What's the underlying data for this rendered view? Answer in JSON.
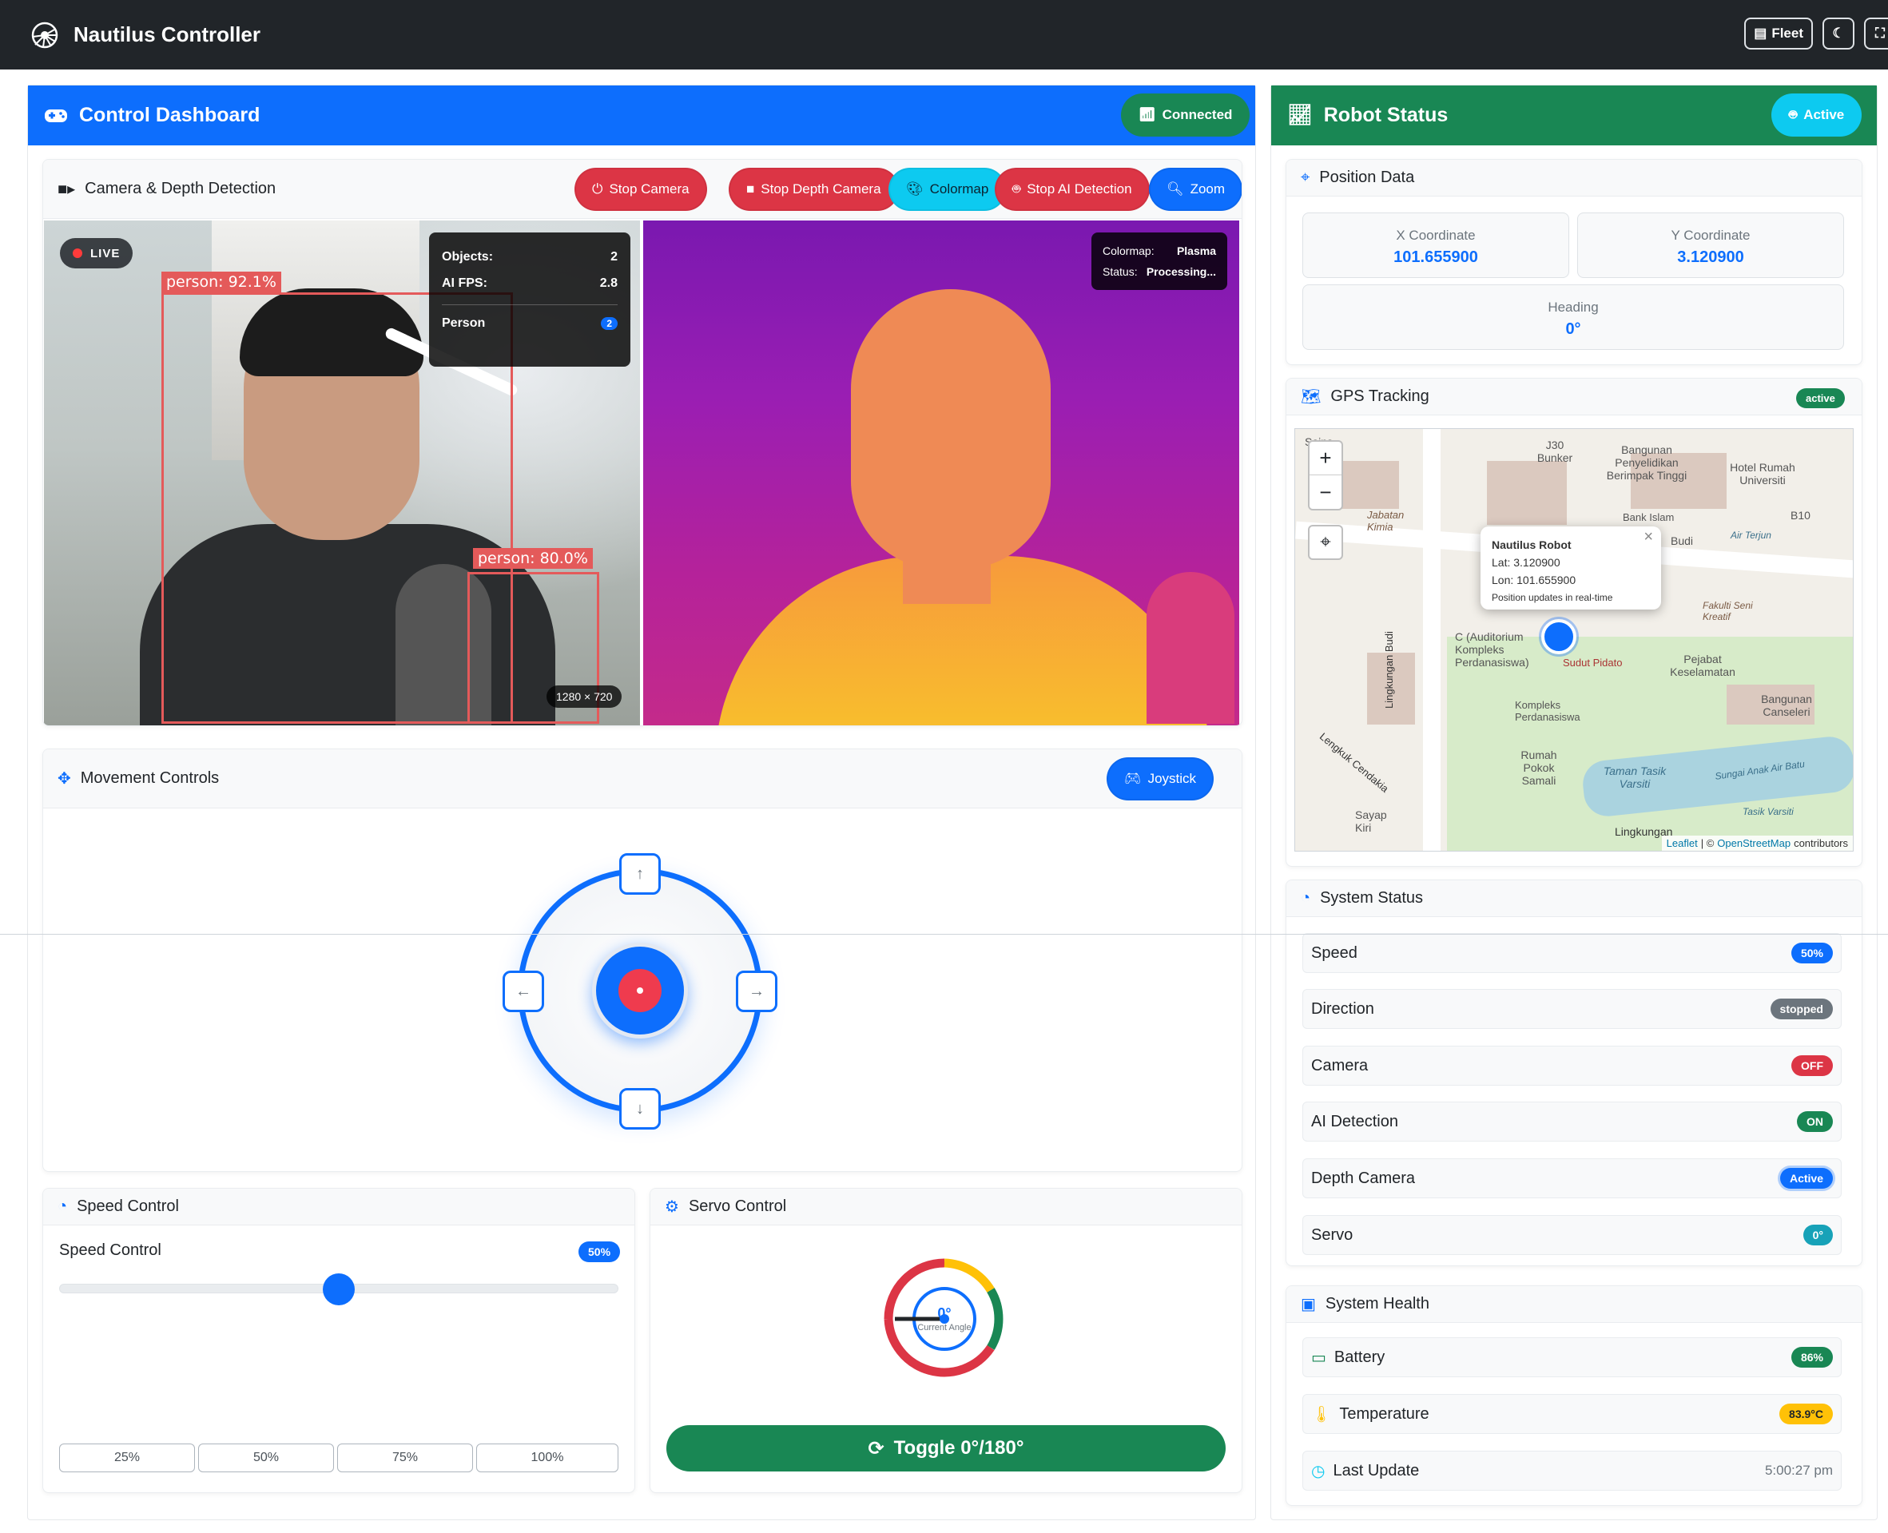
{
  "app": {
    "title": "Nautilus Controller"
  },
  "nav": {
    "fleet_label": "Fleet",
    "theme_icon": "moon-icon",
    "fullscreen_icon": "fullscreen-icon"
  },
  "dashboard": {
    "title": "Control Dashboard",
    "connection": "Connected"
  },
  "camera": {
    "title": "Camera & Depth Detection",
    "buttons": {
      "stop_camera": "Stop Camera",
      "stop_depth": "Stop Depth Camera",
      "colormap": "Colormap",
      "stop_ai": "Stop AI Detection",
      "zoom": "Zoom"
    },
    "live_label": "LIVE",
    "detections": [
      {
        "label": "person: 92.1%"
      },
      {
        "label": "person: 80.0%"
      }
    ],
    "stats": {
      "objects_label": "Objects:",
      "objects_value": "2",
      "fps_label": "AI FPS:",
      "fps_value": "2.8",
      "class_label": "Person",
      "class_count": "2"
    },
    "resolution": "1280 × 720",
    "depth": {
      "colormap_label": "Colormap:",
      "colormap_value": "Plasma",
      "status_label": "Status:",
      "status_value": "Processing..."
    }
  },
  "movement": {
    "title": "Movement Controls",
    "mode_button": "Joystick",
    "arrows": {
      "up": "↑",
      "down": "↓",
      "left": "←",
      "right": "→"
    }
  },
  "speed": {
    "title": "Speed Control",
    "label": "Speed Control",
    "value": "50%",
    "value_fraction": 0.5,
    "presets": [
      "25%",
      "50%",
      "75%",
      "100%"
    ]
  },
  "servo": {
    "title": "Servo Control",
    "angle": "0°",
    "angle_caption": "Current Angle",
    "toggle_label": "Toggle 0°/180°"
  },
  "robot_status": {
    "title": "Robot Status",
    "state": "Active",
    "position": {
      "title": "Position Data",
      "x_label": "X Coordinate",
      "x_value": "101.655900",
      "y_label": "Y Coordinate",
      "y_value": "3.120900",
      "heading_label": "Heading",
      "heading_value": "0°"
    },
    "gps": {
      "title": "GPS Tracking",
      "state": "active",
      "zoom_in": "+",
      "zoom_out": "−",
      "popup": {
        "title": "Nautilus Robot",
        "lat": "Lat: 3.120900",
        "lon": "Lon: 101.655900",
        "note": "Position updates in real-time",
        "close": "×"
      },
      "map_labels": [
        "Sains",
        "J30 Bunker",
        "Bangunan Penyelidikan Berimpak Tinggi",
        "Hotel Rumah Universiti",
        "B10",
        "Bank Islam",
        "Jabatan Kimia",
        "Budi",
        "Air Terjun",
        "Fakulti Seni Kreatif",
        "C (Auditorium Kompleks Perdanasiswa)",
        "Sudut Pidato",
        "Pejabat Keselamatan",
        "Kompleks Perdanasiswa",
        "Bangunan Canseleri",
        "Lingkungan Budi",
        "Lengkuk Cendakia",
        "Rumah Pokok Samali",
        "Taman Tasik Varsiti",
        "Sungai Anak Air Batu",
        "Tasik Varsiti",
        "Sayap Kiri",
        "Lingkungan"
      ],
      "attribution": {
        "leaflet": "Leaflet",
        "separator": "| ©",
        "osm": "OpenStreetMap",
        "suffix": "contributors"
      }
    },
    "system": {
      "title": "System Status",
      "rows": [
        {
          "label": "Speed",
          "value": "50%"
        },
        {
          "label": "Direction",
          "value": "stopped"
        },
        {
          "label": "Camera",
          "value": "OFF"
        },
        {
          "label": "AI Detection",
          "value": "ON"
        },
        {
          "label": "Depth Camera",
          "value": "Active"
        },
        {
          "label": "Servo",
          "value": "0°"
        }
      ]
    },
    "health": {
      "title": "System Health",
      "battery_label": "Battery",
      "battery_value": "86%",
      "temp_label": "Temperature",
      "temp_value": "83.9°C",
      "update_label": "Last Update",
      "update_value": "5:00:27 pm"
    }
  },
  "colors": {
    "primary": "#0d6efd",
    "success": "#198754",
    "danger": "#dc3545",
    "info": "#0dcaf0",
    "warning": "#ffc107",
    "navbar": "#212529"
  }
}
